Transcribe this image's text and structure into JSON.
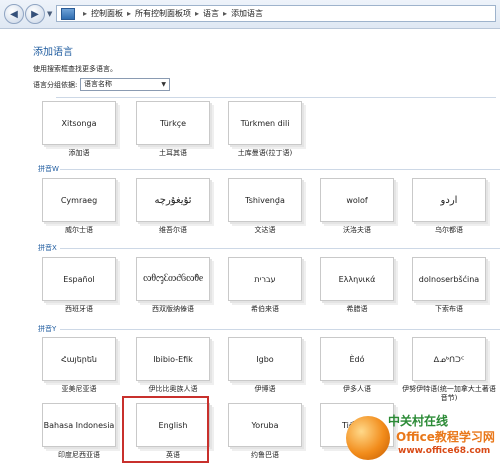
{
  "addressbar": {
    "back_icon": "arrow-left",
    "forward_icon": "arrow-right",
    "breadcrumbs": [
      "控制面板",
      "所有控制面板项",
      "语言",
      "添加语言"
    ]
  },
  "page": {
    "title": "添加语言",
    "hint": "使用搜索框查找更多语言。",
    "group_label": "语言分组依据:",
    "group_select": "语言名称"
  },
  "sections": [
    {
      "header": "拼音W"
    },
    {
      "header": "拼音X"
    },
    {
      "header": "拼音Y"
    }
  ],
  "rows": [
    [
      {
        "native": "Xitsonga",
        "name": "添加语"
      },
      {
        "native": "Türkçe",
        "name": "土耳其语"
      },
      {
        "native": "Türkmen dili",
        "name": "土库曼语(拉丁语)"
      }
    ],
    [
      {
        "native": "Cymraeg",
        "name": "威尔士语"
      },
      {
        "native": "ئۇيغۇرچە",
        "name": "维吾尔语"
      },
      {
        "native": "Tshivenḓa",
        "name": "文达语"
      },
      {
        "native": "wolof",
        "name": "沃洛夫语"
      },
      {
        "native": "اردو",
        "name": "乌尔都语"
      }
    ],
    [
      {
        "native": "Español",
        "name": "西班牙语"
      },
      {
        "native": "ᦟᦲᧅᦷᦎᦺᦑᦟᦹᧉ",
        "name": "西双版纳傣语"
      },
      {
        "native": "עברית",
        "name": "希伯来语"
      },
      {
        "native": "Ελληνικά",
        "name": "希腊语"
      },
      {
        "native": "dolnoserbšćina",
        "name": "下索布语"
      }
    ],
    [
      {
        "native": "Հայերեն",
        "name": "亚美尼亚语"
      },
      {
        "native": "Ibibio-Efik",
        "name": "伊比比奥族人语"
      },
      {
        "native": "Igbo",
        "name": "伊博语"
      },
      {
        "native": "Èdó",
        "name": "伊多人语"
      },
      {
        "native": "ᐃᓄᒃᑎᑐᑦ",
        "name": "伊努伊特语(统一加拿大土著语音节)"
      }
    ],
    [
      {
        "native": "Bahasa Indonesia",
        "name": "印度尼西亚语"
      },
      {
        "native": "English",
        "name": "英语"
      },
      {
        "native": "Yoruba",
        "name": "约鲁巴语"
      },
      {
        "native": "Tiếng V",
        "name": ""
      }
    ]
  ],
  "watermark": {
    "brand": "中关村在线",
    "title": "Office教程学习网",
    "url": "www.office68.com"
  }
}
